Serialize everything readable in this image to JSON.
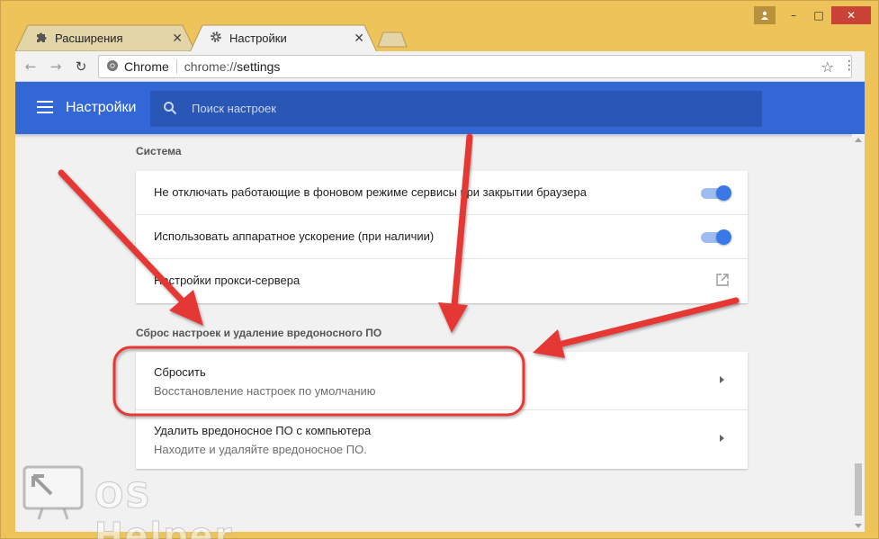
{
  "window": {
    "tabs": [
      {
        "label": "Расширения",
        "icon": "puzzle-icon"
      },
      {
        "label": "Настройки",
        "icon": "gear-icon",
        "active": true
      }
    ]
  },
  "toolbar": {
    "omnibox_chip": "Chrome",
    "url_prefix": "chrome://",
    "url_path": "settings"
  },
  "appbar": {
    "title": "Настройки",
    "search_placeholder": "Поиск настроек",
    "color": "#3367d6"
  },
  "sections": {
    "system": {
      "title": "Система",
      "items": [
        {
          "label": "Не отключать работающие в фоновом режиме сервисы при закрытии браузера",
          "toggle": true
        },
        {
          "label": "Использовать аппаратное ускорение (при наличии)",
          "toggle": true
        },
        {
          "label": "Настройки прокси-сервера",
          "icon": "open-in-new-icon"
        }
      ]
    },
    "reset": {
      "title": "Сброс настроек и удаление вредоносного ПО",
      "items": [
        {
          "label": "Сбросить",
          "sub": "Восстановление настроек по умолчанию"
        },
        {
          "label": "Удалить вредоносное ПО с компьютера",
          "sub": "Находите и удаляйте вредоносное ПО."
        }
      ]
    }
  },
  "watermark": {
    "text": "OS Helper"
  },
  "colors": {
    "annotation": "#e53935",
    "toggle_on": "#3b78e7"
  }
}
